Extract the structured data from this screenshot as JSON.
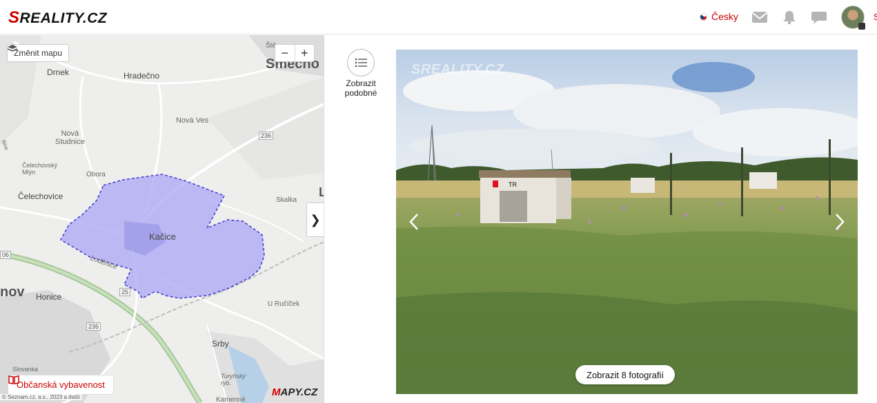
{
  "header": {
    "logo": "SREALITY.CZ",
    "language": "Česky",
    "icons": [
      "flag-cz-icon",
      "mail-icon",
      "bell-icon",
      "chat-icon",
      "avatar",
      "lock-icon"
    ],
    "user_initial": "S"
  },
  "map": {
    "change_map_label": "Změnit mapu",
    "zoom_out": "−",
    "zoom_in": "+",
    "collapse_label": "❯",
    "poi_button_label": "Občanská vybavenost",
    "provider_logo": "MAPY.CZ",
    "copyright": "© Seznam.cz, a.s., 2023 a další",
    "highlight_color": "#a9a6f5",
    "places": {
      "drnek": "Drnek",
      "hradecno": "Hradečno",
      "smecno": "Smecno",
      "stepanovice": "Ště",
      "nova_studnice": "Nová\nStudnice",
      "nova_ves": "Nová Ves",
      "celechovsky_mlyn": "Čelechovský\nMlýn",
      "obora": "Obora",
      "celechovice": "Čelechovice",
      "skalka": "Skalka",
      "kacice": "Kačice",
      "lodenice": "Loděnice",
      "honice": "Honice",
      "u_rucicek": "U Ručíček",
      "srby": "Srby",
      "slovanka": "Slovanka",
      "turynsky_ryb": "Turyňský\nryb.",
      "kamenne": "Kamenné",
      "nov": "nov",
      "edge_l": "L",
      "edge_06": "06",
      "edge_ltine": "ltine"
    },
    "roads": {
      "r236_top": "236",
      "r236_bottom": "236",
      "r25": "25"
    }
  },
  "similar": {
    "label": "Zobrazit\npodobné",
    "icon": "list-icon"
  },
  "gallery": {
    "watermark": "SREALITY.CZ",
    "prev_icon": "chevron-left-icon",
    "next_icon": "chevron-right-icon",
    "photos_button_label": "Zobrazit 8 fotografií",
    "box_label": "TR"
  }
}
